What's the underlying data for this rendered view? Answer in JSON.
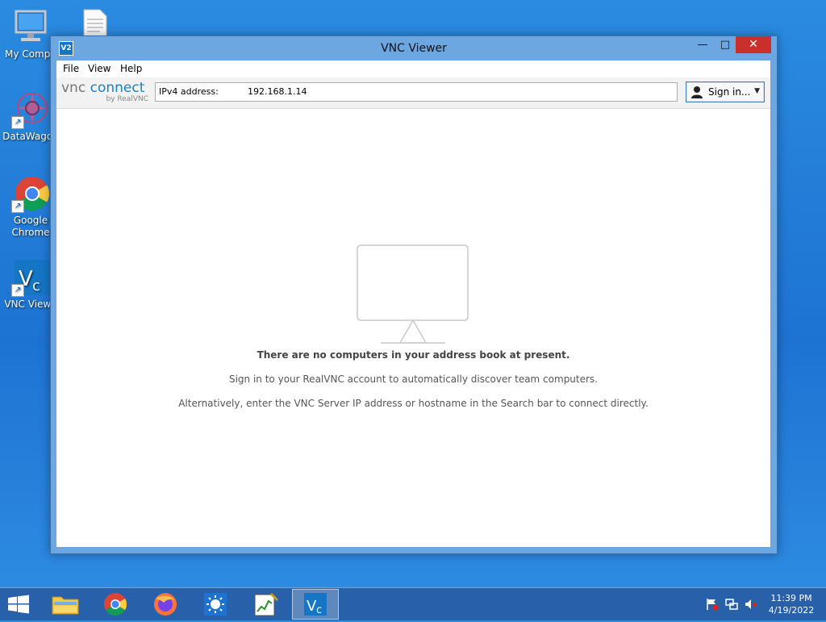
{
  "desktop": {
    "icons": [
      {
        "label": "My Compu"
      },
      {
        "label": ""
      },
      {
        "label": "DataWagon"
      },
      {
        "label": "Google Chrome"
      },
      {
        "label": "VNC Viewe"
      }
    ]
  },
  "window": {
    "title": "VNC Viewer",
    "app_icon_text": "V2",
    "controls": {
      "minimize": "—",
      "maximize": "□",
      "close": "✕"
    },
    "menu": [
      {
        "label": "File"
      },
      {
        "label": "View"
      },
      {
        "label": "Help"
      }
    ],
    "logo": {
      "vnc": "vnc",
      "connect": "connect",
      "byline": "by RealVNC"
    },
    "address": {
      "label": "IPv4 address:",
      "value": "192.168.1.14"
    },
    "signin": {
      "label": "Sign in...",
      "caret": "▼"
    },
    "empty_state": {
      "heading": "There are no computers in your address book at present.",
      "line1": "Sign in to your RealVNC account to automatically discover team computers.",
      "line2": "Alternatively, enter the VNC Server IP address or hostname in the Search bar to connect directly."
    }
  },
  "taskbar": {
    "pinned": [
      {
        "name": "file-explorer-icon"
      },
      {
        "name": "chrome-icon"
      },
      {
        "name": "firefox-icon"
      },
      {
        "name": "weather-app-icon"
      },
      {
        "name": "chart-app-icon"
      },
      {
        "name": "vnc-viewer-icon",
        "active": true
      }
    ],
    "tray": [
      "action-center-flag-icon",
      "network-icon",
      "volume-muted-icon"
    ],
    "clock": {
      "time": "11:39 PM",
      "date": "4/19/2022"
    }
  },
  "colors": {
    "desktop_bg": "#1e73d2",
    "window_frame": "#6da7e2",
    "close_button": "#c9302c",
    "vnc_blue": "#1e7fc6"
  }
}
